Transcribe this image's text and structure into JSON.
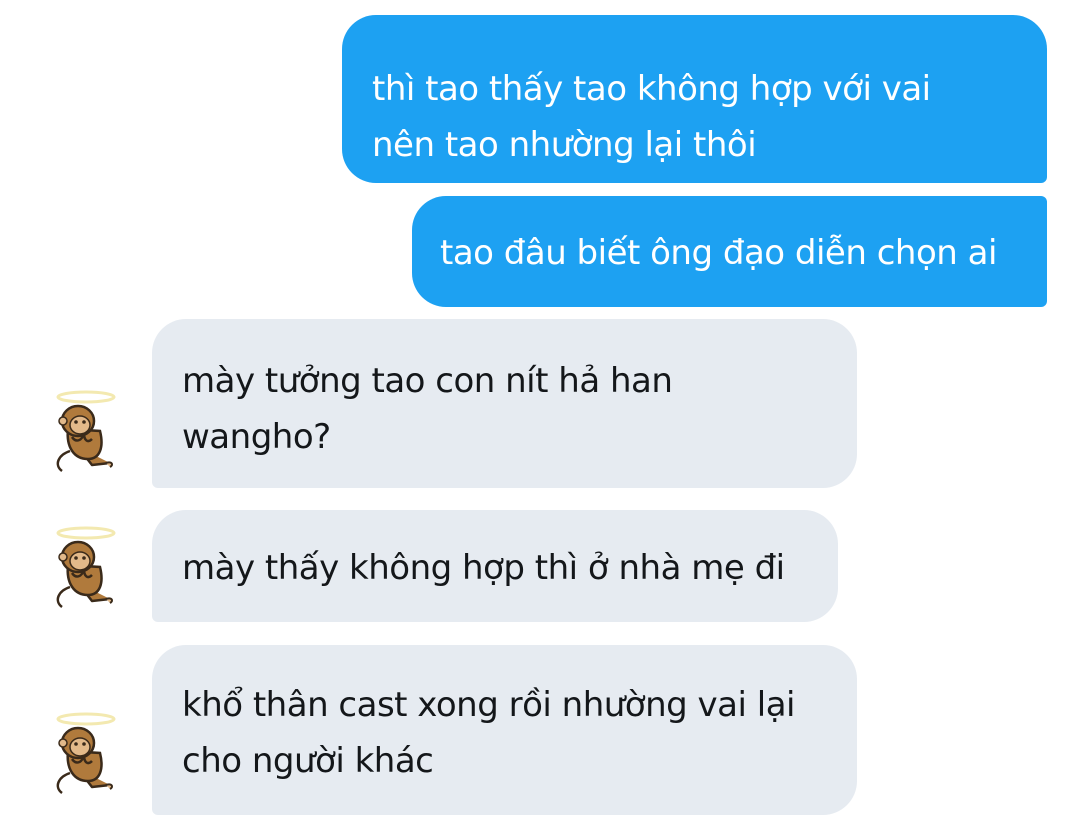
{
  "conversation": {
    "messages": [
      {
        "direction": "sent",
        "lines": [
          "thì tao thấy tao không hợp với vai",
          "nên tao nhường lại thôi"
        ]
      },
      {
        "direction": "sent",
        "lines": [
          "tao đâu biết ông đạo diễn chọn ai"
        ]
      },
      {
        "direction": "received",
        "lines": [
          "mày tưởng tao con nít hả han",
          "wangho?"
        ]
      },
      {
        "direction": "received",
        "lines": [
          "mày thấy không hợp thì ở nhà mẹ đi"
        ]
      },
      {
        "direction": "received",
        "lines": [
          "khổ thân cast xong rồi nhường vai lại",
          "cho người khác"
        ]
      }
    ]
  },
  "colors": {
    "sent_bubble": "#1da1f2",
    "received_bubble": "#e6ebf1",
    "sent_text": "#ffffff",
    "received_text": "#14171a"
  },
  "icons": {
    "avatar": "monkey-avatar-icon"
  }
}
